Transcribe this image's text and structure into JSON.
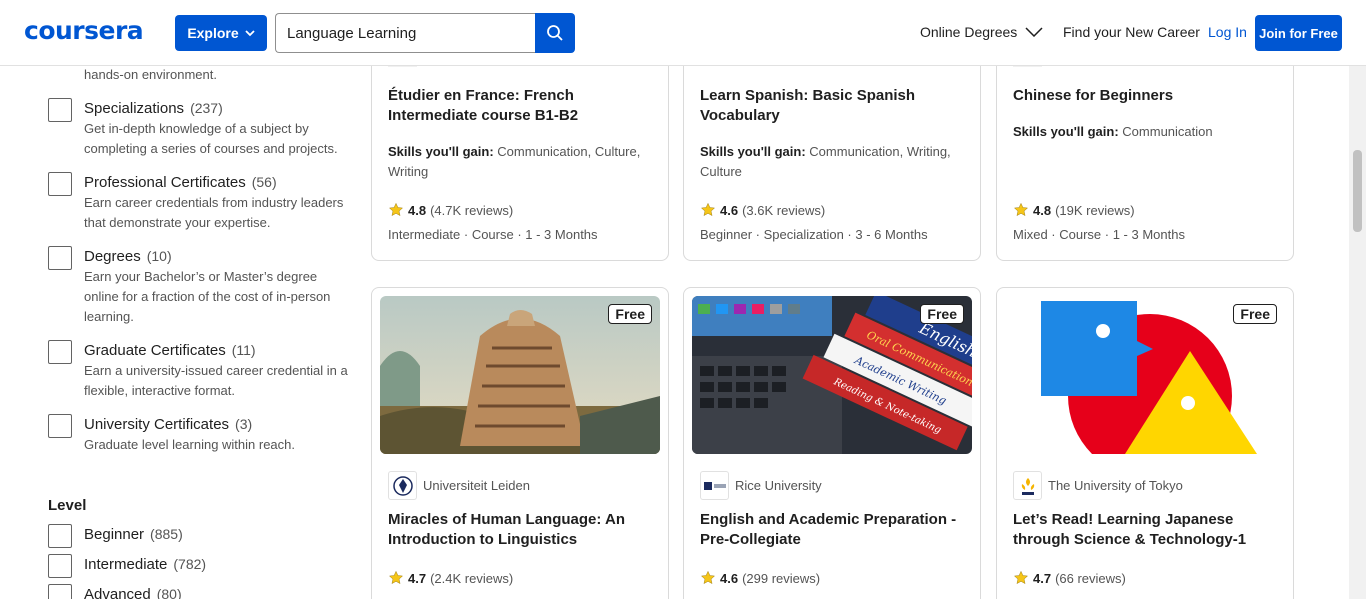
{
  "header": {
    "logo": "coursera",
    "explore_label": "Explore",
    "search_value": "Language Learning",
    "nav_online_degrees": "Online Degrees",
    "nav_find_career": "Find your New Career",
    "nav_login": "Log In",
    "nav_join": "Join for Free"
  },
  "sidebar": {
    "partial_desc": "hands-on environment.",
    "filters": [
      {
        "label": "Specializations",
        "count": "(237)",
        "desc": "Get in-depth knowledge of a subject by completing a series of courses and projects."
      },
      {
        "label": "Professional Certificates",
        "count": "(56)",
        "desc": "Earn career credentials from industry leaders that demonstrate your expertise."
      },
      {
        "label": "Degrees",
        "count": "(10)",
        "desc": "Earn your Bachelor’s or Master’s degree online for a fraction of the cost of in-person learning."
      },
      {
        "label": "Graduate Certificates",
        "count": "(11)",
        "desc": "Earn a university-issued career credential in a flexible, interactive format."
      },
      {
        "label": "University Certificates",
        "count": "(3)",
        "desc": "Graduate level learning within reach."
      }
    ],
    "level_heading": "Level",
    "levels": [
      {
        "label": "Beginner",
        "count": "(885)"
      },
      {
        "label": "Intermediate",
        "count": "(782)"
      },
      {
        "label": "Advanced",
        "count": "(80)"
      }
    ]
  },
  "cards_top": [
    {
      "title": "Étudier en France: French Intermediate course B1-B2",
      "skills_label": "Skills you'll gain:",
      "skills": "Communication, Culture, Writing",
      "rating": "4.8",
      "reviews": "(4.7K reviews)",
      "meta": "Intermediate · Course · 1 - 3 Months"
    },
    {
      "title": "Learn Spanish: Basic Spanish Vocabulary",
      "skills_label": "Skills you'll gain:",
      "skills": "Communication, Writing, Culture",
      "rating": "4.6",
      "reviews": "(3.6K reviews)",
      "meta": "Beginner · Specialization · 3 - 6 Months"
    },
    {
      "title": "Chinese for Beginners",
      "skills_label": "Skills you'll gain:",
      "skills": "Communication",
      "rating": "4.8",
      "reviews": "(19K reviews)",
      "meta": "Mixed · Course · 1 - 3 Months"
    }
  ],
  "cards_bottom": [
    {
      "badge": "Free",
      "partner": "Universiteit Leiden",
      "title": "Miracles of Human Language: An Introduction to Linguistics",
      "rating": "4.7",
      "reviews": "(2.4K reviews)"
    },
    {
      "badge": "Free",
      "partner": "Rice University",
      "title": "English and Academic Preparation - Pre-Collegiate",
      "rating": "4.6",
      "reviews": "(299 reviews)"
    },
    {
      "badge": "Free",
      "partner": "The University of Tokyo",
      "title": "Let’s Read! Learning Japanese through Science & Technology-1",
      "rating": "4.7",
      "reviews": "(66 reviews)"
    }
  ],
  "image_texts": {
    "book1": "English",
    "book2": "Oral Communication",
    "book3": "Academic Writing",
    "book4": "Reading & Note-taking"
  },
  "colors": {
    "brand": "#0056d2",
    "star": "#f5c518"
  }
}
